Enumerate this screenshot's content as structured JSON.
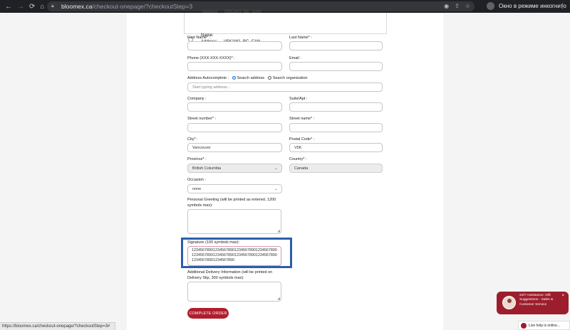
{
  "browser": {
    "url_host": "bloomex.ca",
    "url_path": "/checkout-onepage/?checkoutStep=3",
    "incognito_label": "Окно в режиме инкогнито"
  },
  "address_option": {
    "name_line": "Name:",
    "address_line": "Address: , , V5K1W1, BC, CAN"
  },
  "form": {
    "first_name_label": "First Name* :",
    "last_name_label": "Last Name* :",
    "phone_label": "Phone (XXX-XXX-XXXX)* :",
    "email_label": "Email :",
    "autocomplete_label": "Address Autocomplete :",
    "search_address_label": "Search address",
    "search_org_label": "Search organization",
    "autocomplete_placeholder": "Start typing address...",
    "company_label": "Company :",
    "suite_label": "Suite/Apt :",
    "street_number_label": "Street number* :",
    "street_name_label": "Street name* :",
    "city_label": "City* :",
    "city_value": "Vancouver",
    "postal_label": "Postal Code* :",
    "postal_value": "V5K",
    "province_label": "Province* :",
    "province_value": "British Columbia",
    "country_label": "Country* :",
    "country_value": "Canada",
    "occasion_label": "Occasion :",
    "occasion_value": "none",
    "greeting_label_1": "Personal Greeting (will be printed as entered, 1200",
    "greeting_label_2": "symbols max):",
    "signature_label": "Signature (100 symbols max):",
    "signature_line_1": "1234567890123456789012345678901234567890",
    "signature_line_2": "1234567890123456789012345678901234567890",
    "signature_line_3": "12345678901234567890",
    "delivery_label_1": "Additional Delivery Information (will be printed on",
    "delivery_label_2": "Delivery Slip, 300 symbols max):",
    "submit_label": "COMPLETE ORDER"
  },
  "status_bar": {
    "url": "https://bloomex.ca/checkout-onepage/?checkoutStep=3#"
  },
  "chat": {
    "popup_line_1": "24/7 Assistance: Gift",
    "popup_line_2": "Suggestions - Sales &",
    "popup_line_3": "Customer Service",
    "close_glyph": "×",
    "bar_label": "Live help is online..."
  },
  "colors": {
    "brand_red": "#b01e2d",
    "highlight_blue": "#2c5eaa"
  }
}
